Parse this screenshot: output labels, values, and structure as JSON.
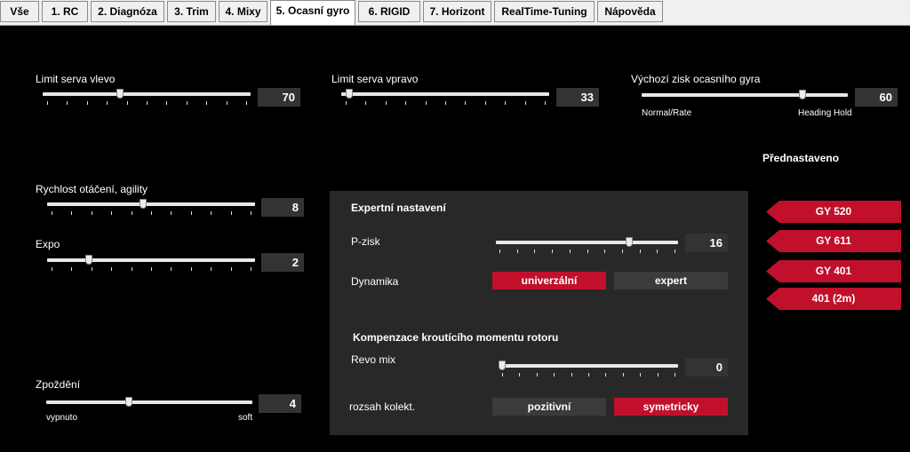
{
  "tabs": [
    {
      "label": "Vše"
    },
    {
      "label": "1. RC"
    },
    {
      "label": "2. Diagnóza"
    },
    {
      "label": "3. Trim"
    },
    {
      "label": "4. Mixy"
    },
    {
      "label": "5. Ocasní gyro"
    },
    {
      "label": "6. RIGID"
    },
    {
      "label": "7. Horizont"
    },
    {
      "label": "RealTime-Tuning"
    },
    {
      "label": "Nápověda"
    }
  ],
  "active_tab": "5. Ocasní gyro",
  "limit_left": {
    "label": "Limit serva vlevo",
    "value": "70",
    "fraction": 0.37
  },
  "limit_right": {
    "label": "Limit serva vpravo",
    "value": "33",
    "fraction": 0.04
  },
  "default_gain": {
    "label": "Výchozí zisk ocasního gyra",
    "value": "60",
    "fraction": 0.78,
    "left_caption": "Normal/Rate",
    "right_caption": "Heading Hold"
  },
  "presets": {
    "title": "Přednastaveno",
    "items": [
      {
        "label": "GY 520"
      },
      {
        "label": "GY 611"
      },
      {
        "label": "GY 401"
      },
      {
        "label": "401 (2m)"
      }
    ]
  },
  "agility": {
    "label": "Rychlost otáčení, agility",
    "value": "8",
    "fraction": 0.46
  },
  "expo": {
    "label": "Expo",
    "value": "2",
    "fraction": 0.2
  },
  "delay": {
    "label": "Zpoždění",
    "value": "4",
    "fraction": 0.4,
    "left_caption": "vypnuto",
    "right_caption": "soft"
  },
  "expert": {
    "title": "Expertní nastavení",
    "p_gain": {
      "label": "P-zisk",
      "value": "16",
      "fraction": 0.73
    },
    "dynamics": {
      "label": "Dynamika",
      "options": [
        {
          "label": "univerzální",
          "selected": true
        },
        {
          "label": "expert",
          "selected": false
        }
      ]
    },
    "compensation_title": "Kompenzace kroutícího momentu rotoru",
    "revo_mix": {
      "label": "Revo mix",
      "value": "0",
      "fraction": 0.0
    },
    "collective_range": {
      "label": "rozsah kolekt.",
      "options": [
        {
          "label": "pozitivní",
          "selected": false
        },
        {
          "label": "symetricky",
          "selected": true
        }
      ]
    }
  },
  "colors": {
    "accent": "#c0102c",
    "background": "#000000",
    "panel": "#282828",
    "value_box": "#333333"
  }
}
